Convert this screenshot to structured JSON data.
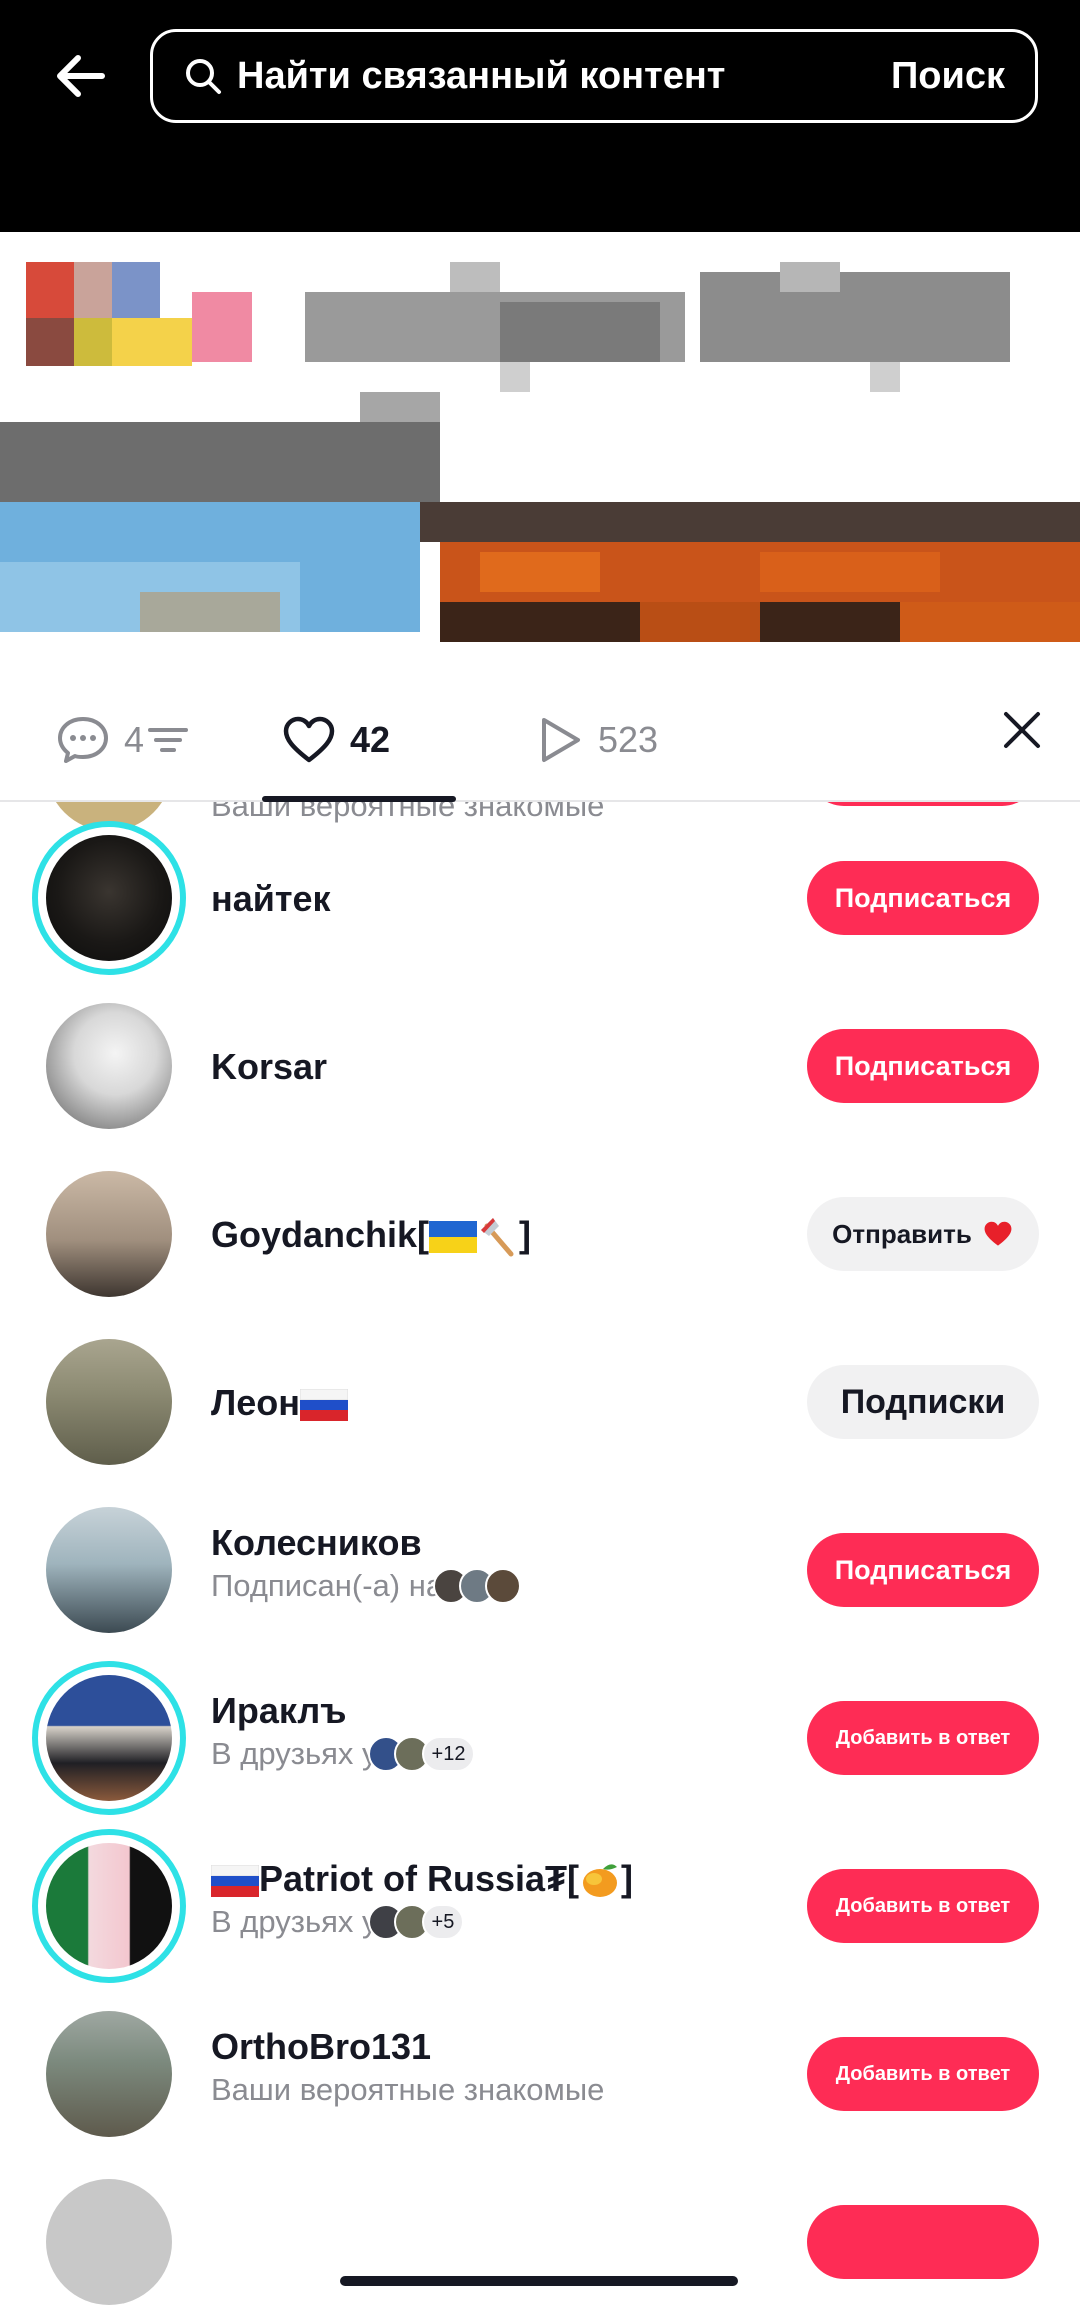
{
  "header": {
    "search_placeholder": "Найти связанный контент",
    "search_button": "Поиск"
  },
  "tabs": {
    "comments_count": "4",
    "likes_count": "42",
    "views_count": "523"
  },
  "partial_top_row": {
    "subtitle": "Ваши вероятные знакомые"
  },
  "users": [
    {
      "name": "найтек",
      "subtitle": "",
      "button": "Подписаться"
    },
    {
      "name": "Korsar",
      "subtitle": "",
      "button": "Подписаться"
    },
    {
      "name": "Goydanchik[",
      "name_suffix": "]",
      "subtitle": "",
      "button": "Отправить"
    },
    {
      "name": "Леон",
      "subtitle": "",
      "button": "Подписки"
    },
    {
      "name": "Колесников",
      "subtitle": "Подписан(-а) на",
      "button": "Подписаться"
    },
    {
      "name": "Ираклъ",
      "subtitle": "В друзьях у",
      "mutual_count": "+12",
      "button": "Добавить в ответ"
    },
    {
      "name": "Patriot of Russia₮[",
      "name_suffix": "]",
      "subtitle": "В друзьях у",
      "mutual_count": "+5",
      "button": "Добавить в ответ"
    },
    {
      "name": "OrthoBro131",
      "subtitle": "Ваши вероятные знакомые",
      "button": "Добавить в ответ"
    }
  ],
  "colors": {
    "accent_red": "#fe2c55",
    "story_ring": "#2ee1e6",
    "muted_text": "#8a8b91"
  }
}
